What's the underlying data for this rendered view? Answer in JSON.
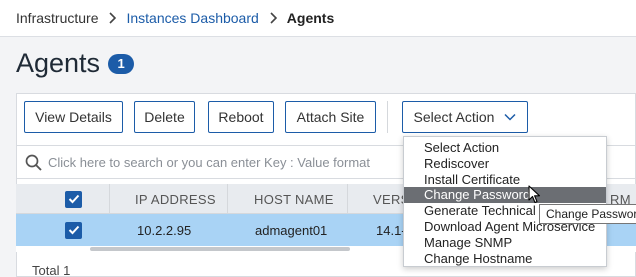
{
  "breadcrumb": {
    "items": [
      "Infrastructure",
      "Instances Dashboard",
      "Agents"
    ]
  },
  "page": {
    "title": "Agents",
    "count": "1"
  },
  "toolbar": {
    "view_details": "View Details",
    "delete": "Delete",
    "reboot": "Reboot",
    "attach_site": "Attach Site",
    "select_action": "Select Action"
  },
  "search": {
    "placeholder": "Click here to search or you can enter Key : Value format"
  },
  "table": {
    "headers": {
      "ip": "IP ADDRESS",
      "host": "HOST NAME",
      "version": "VERSI",
      "platform": "RM"
    },
    "rows": [
      {
        "selected": true,
        "ip": "10.2.2.95",
        "host": "admagent01",
        "version": "14.1-"
      }
    ]
  },
  "footer": {
    "total": "Total 1"
  },
  "dropdown": {
    "items": [
      "Select Action",
      "Rediscover",
      "Install Certificate",
      "Change Password",
      "Generate Technical Support File",
      "Download Agent Microservice",
      "Manage SNMP",
      "Change Hostname"
    ],
    "highlighted_index": 3
  },
  "tooltip": {
    "text": "Change Password"
  },
  "colors": {
    "accent": "#1c5ca8",
    "selected_row": "#a9d3f5",
    "menu_highlight": "#6b6e73"
  }
}
